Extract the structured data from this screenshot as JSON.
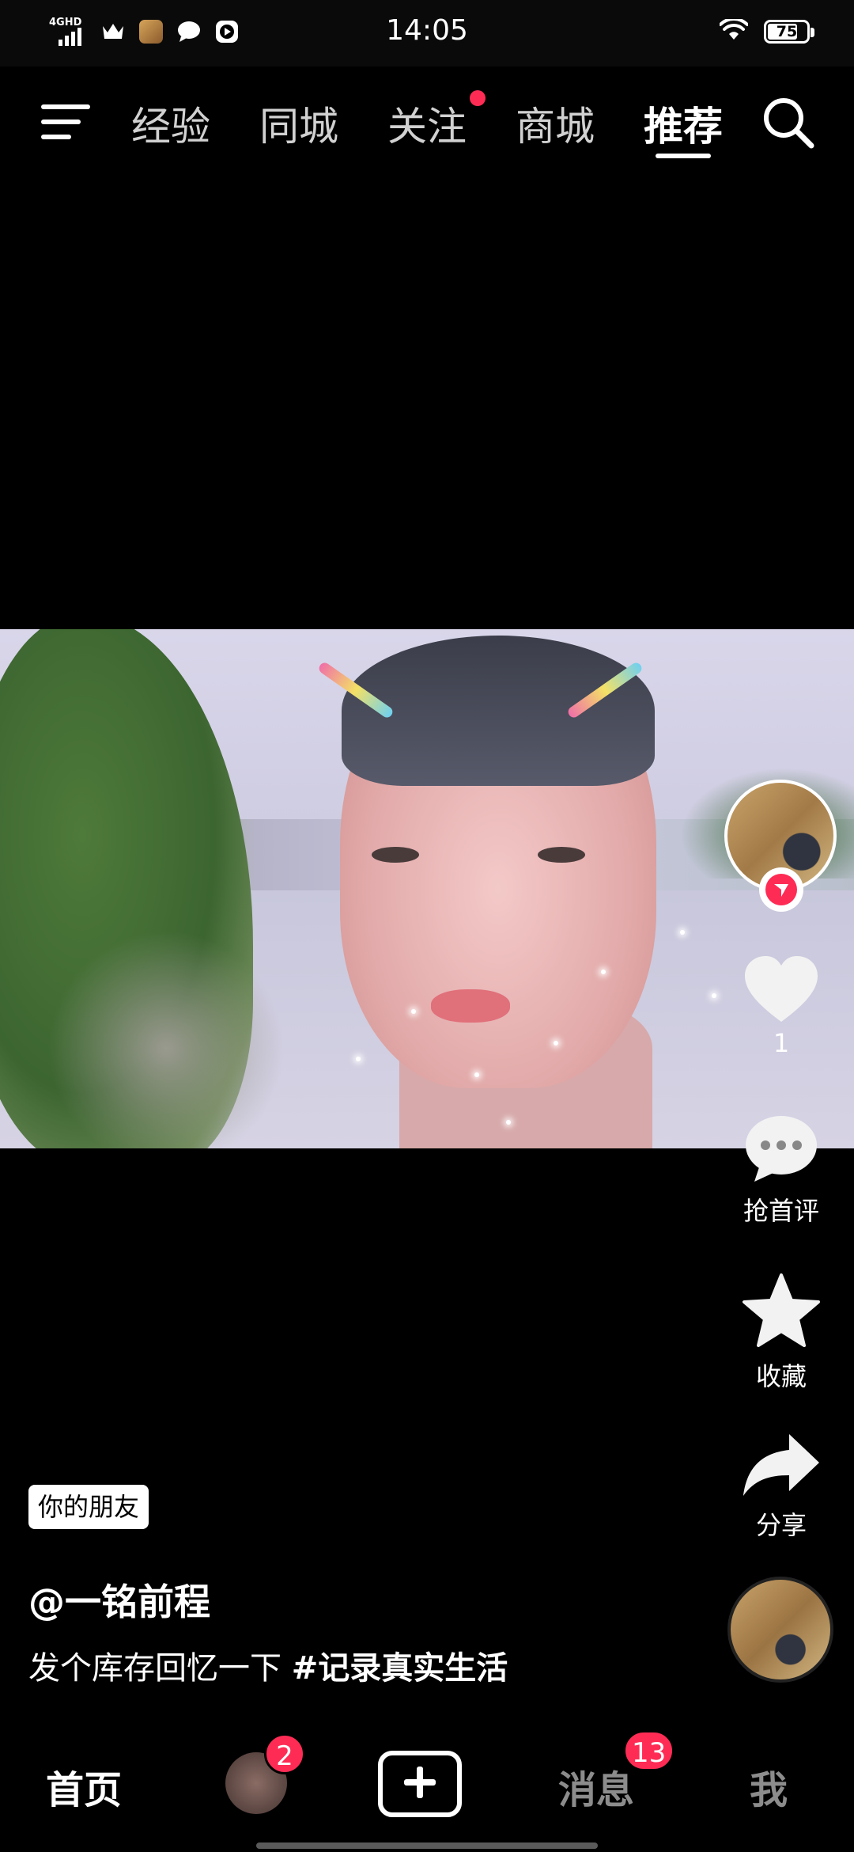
{
  "status_bar": {
    "network": "4GHD",
    "time": "14:05",
    "battery": "75",
    "icons": [
      "signal-icon",
      "crown-icon",
      "game-app-icon",
      "chat-bubble-icon",
      "video-player-icon",
      "wifi-icon",
      "battery-icon"
    ]
  },
  "top_nav": {
    "tabs": [
      {
        "label": "经验"
      },
      {
        "label": "同城"
      },
      {
        "label": "关注"
      },
      {
        "label": "商城"
      },
      {
        "label": "推荐"
      }
    ],
    "active_tab": "推荐",
    "icons": [
      "menu-icon",
      "search-icon"
    ],
    "notification_dot_color": "#fe2c55"
  },
  "right_rail": {
    "like_count": "1",
    "comment_label": "抢首评",
    "favorite_label": "收藏",
    "share_label": "分享",
    "icons": [
      "heart-icon",
      "comment-icon",
      "star-icon",
      "share-icon"
    ]
  },
  "caption": {
    "friend_tag": "你的朋友",
    "username": "@一铭前程",
    "text": "发个库存回忆一下 ",
    "hashtag": "#记录真实生活"
  },
  "bottom_nav": {
    "home": "首页",
    "friends_badge": "2",
    "messages": "消息",
    "messages_badge": "13",
    "me": "我",
    "accent": "#fe2c55"
  }
}
